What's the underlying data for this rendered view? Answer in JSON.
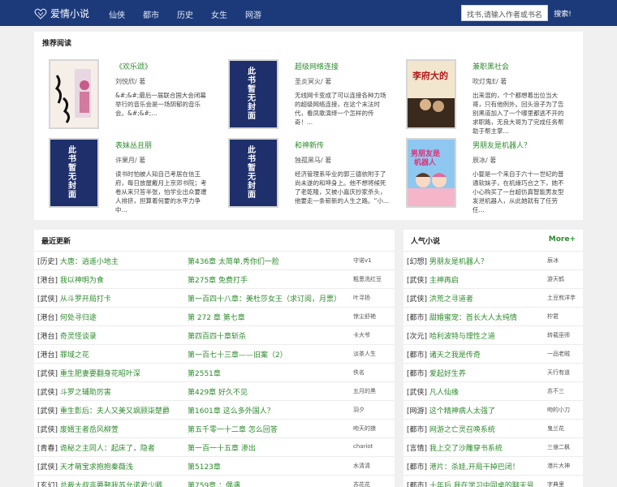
{
  "header": {
    "site_name": "爱情小说",
    "nav": [
      "仙侠",
      "都市",
      "历史",
      "女生",
      "网游"
    ],
    "search_placeholder": "找书,请输入作者或书名",
    "search_button": "搜索!"
  },
  "recommend": {
    "title": "推荐阅读",
    "items": [
      {
        "name": "《欢乐颂》",
        "author": "刘悦欣/ 著",
        "desc": "&#;&#;最后一届联合国大会闭幕举行的音乐会是一场阴郁的音乐会。&#;&#;...",
        "cover_text": "欢乐颂"
      },
      {
        "name": "超级网络连接",
        "author": "圣炎冥火/ 著",
        "desc": "无线网卡变成了可以连接各种力场的超级网络连接，在这个末法时代，看凤歌演绎一个怎样的传奇！...",
        "cover_text": "此书暂无封面"
      },
      {
        "name": "兼职黑社会",
        "author": "吹灯鬼E/ 著",
        "desc": "出来混的，个个都想着出位当大哥，只有他例外。回头浪子为了告别黑道加入了一个哪里都逃不开的求职路，无良大哥为了完成任务帮助于帮主掌...",
        "cover_text": "李府大的"
      },
      {
        "name": "表妹丛且朋",
        "author": "许果月/ 著",
        "desc": "读书时怕被人知自己考居在信王府，每日放屋戴月上京郊书院；考卷从来只答半张，怕学业出众要遭人排挤，担算着何要的水平力争中...",
        "cover_text": "此书暂无封面"
      },
      {
        "name": "和神新传",
        "author": "独孤黑马/ 著",
        "desc": "经济管理系毕业的郭三德依附于了尚未遂的和坤身上。他不想将候死了老乾隆，又被小嘉庆抄家杀头，他要走一条崭新的人生之路。“小...",
        "cover_text": "此书暂无封面"
      },
      {
        "name": "男朋友是机器人？",
        "author": "辰冰/ 著",
        "desc": "小婴是一个来自于六十一世纪的普通软妹子，在机缘巧合之下，她不小心购买了一台超仿真智能男友型发泄机器人，从此她就有了任劳任...",
        "cover_text": "男朋友是机器人"
      }
    ]
  },
  "updates": {
    "title": "最近更新",
    "rows": [
      {
        "cat": "[历史]",
        "title": "大唐：逍遥小地主",
        "chapter": "第436章 太简单,秀你们一脸",
        "author": "守诺v1"
      },
      {
        "cat": "[港台]",
        "title": "我以神明为食",
        "chapter": "第275章 免费打手",
        "author": "粗恩洗红豆"
      },
      {
        "cat": "[武侠]",
        "title": "从斗罗开局打卡",
        "chapter": "第一百四十八章：美杜莎女王（求订阅，月票）",
        "author": "叶寻扬"
      },
      {
        "cat": "[港台]",
        "title": "何处寻归途",
        "chapter": "第 272 章 第七章",
        "author": "惊尘舒艳"
      },
      {
        "cat": "[港台]",
        "title": "奇灵怪谈录",
        "chapter": "第四百四十章斩杀",
        "author": "卡大爷"
      },
      {
        "cat": "[港台]",
        "title": "罪域之花",
        "chapter": "第一百七十三章——旧案（2）",
        "author": "淡茶人生"
      },
      {
        "cat": "[武侠]",
        "title": "重生肥妻要翻身花昭叶深",
        "chapter": "第2551章",
        "author": "佚名"
      },
      {
        "cat": "[武侠]",
        "title": "斗罗之辅助厉害",
        "chapter": "第429章 好久不见",
        "author": "五月的黑"
      },
      {
        "cat": "[武侠]",
        "title": "重生影后：夫人又美又飒顾柒楚爵",
        "chapter": "第1601章 这么多外国人？",
        "author": "羽夕"
      },
      {
        "cat": "[武侠]",
        "title": "废婿王者岳风柳萱",
        "chapter": "第五千零一十二章 怎么回答",
        "author": "吻天的狼"
      },
      {
        "cat": "[青春]",
        "title": "诡秘之主同人：起床了，隐者",
        "chapter": "第一百一十五章 渗出",
        "author": "chariot"
      },
      {
        "cat": "[武侠]",
        "title": "天才萌宝求抱抱秦薇浅",
        "chapter": "第5123章",
        "author": "水清清"
      },
      {
        "cat": "[玄幻]",
        "title": "总裁大叔非要娶我苏允诺君少卿",
        "chapter": "第759章 ：偶遇",
        "author": "苏花花"
      }
    ]
  },
  "popular": {
    "title": "人气小说",
    "more": "More+",
    "rows": [
      {
        "cat": "[幻想]",
        "title": "男朋友是机器人？",
        "author": "辰冰"
      },
      {
        "cat": "[武侠]",
        "title": "主神再启",
        "author": "游天鹤"
      },
      {
        "cat": "[武侠]",
        "title": "洪荒之寻道者",
        "author": "土豆煎洋芋"
      },
      {
        "cat": "[都市]",
        "title": "甜婚蜜宠：首长大人太纯情",
        "author": "柠君"
      },
      {
        "cat": "[次元]",
        "title": "哈利波特与理性之道",
        "author": "转载巫师"
      },
      {
        "cat": "[都市]",
        "title": "诸天之我是传奇",
        "author": "一品老贼"
      },
      {
        "cat": "[都市]",
        "title": "爱起好生养",
        "author": "天行有道"
      },
      {
        "cat": "[武侠]",
        "title": "凡人仙缘",
        "author": "苏不三"
      },
      {
        "cat": "[网游]",
        "title": "这个精神病人太强了",
        "author": "吻的小刀"
      },
      {
        "cat": "[都市]",
        "title": "网游之亡灵召唤系统",
        "author": "鬼兰花"
      },
      {
        "cat": "[言情]",
        "title": "我上交了沙雕穿书系统",
        "author": "三億二枫"
      },
      {
        "cat": "[都市]",
        "title": "港片：杀娃,开局干掉巴闭！",
        "author": "港片大神"
      },
      {
        "cat": "[都市]",
        "title": "十年后,我在学习中同桌的聊天号",
        "author": "字典里"
      }
    ]
  }
}
